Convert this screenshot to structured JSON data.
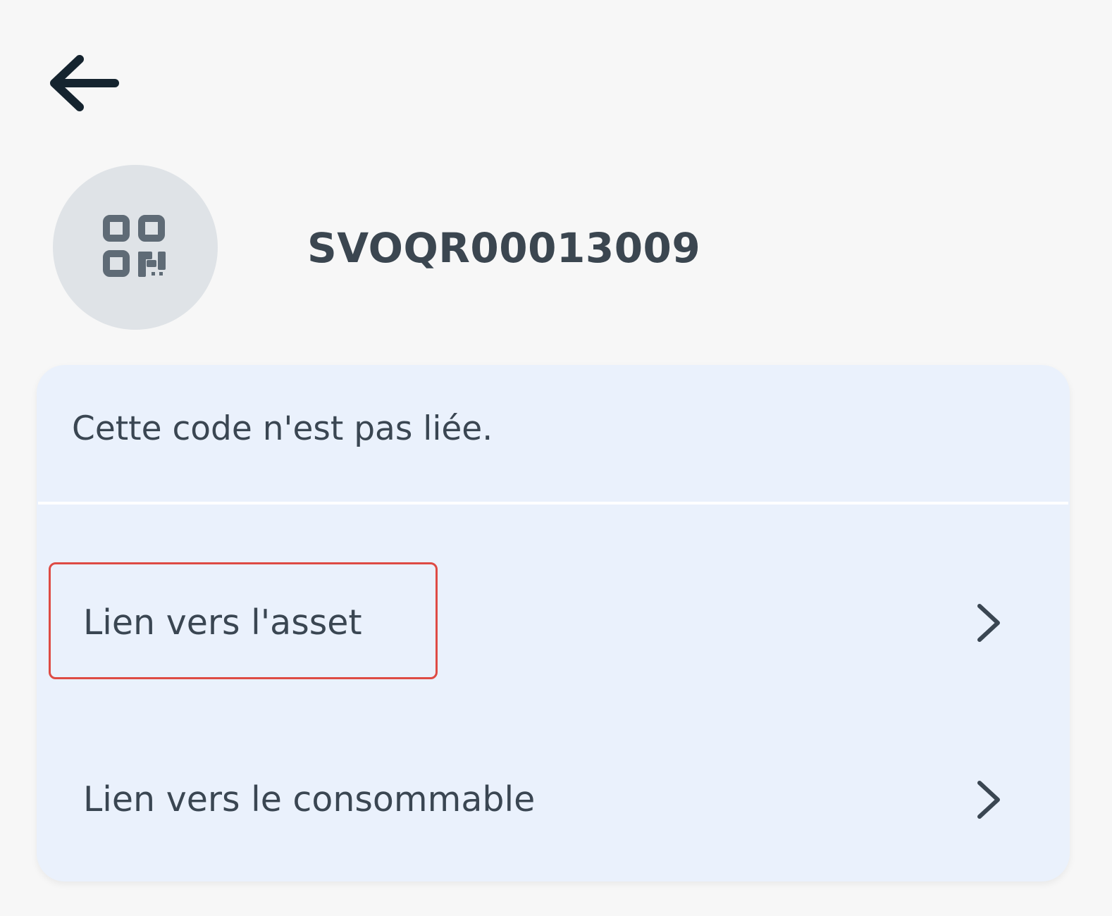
{
  "header": {
    "back_icon": "arrow-left-icon"
  },
  "code": {
    "avatar_icon": "qr-code-icon",
    "title": "SVOQR00013009"
  },
  "card": {
    "message": "Cette code n'est pas liée.",
    "items": [
      {
        "label": "Lien vers l'asset",
        "icon": "chevron-right-icon",
        "highlighted": true
      },
      {
        "label": "Lien vers le consommable",
        "icon": "chevron-right-icon",
        "highlighted": false
      }
    ]
  },
  "colors": {
    "background": "#f7f7f7",
    "card_background": "#eaf1fc",
    "text": "#36424d",
    "avatar_background": "#dfe3e7",
    "highlight": "#de4b44"
  }
}
